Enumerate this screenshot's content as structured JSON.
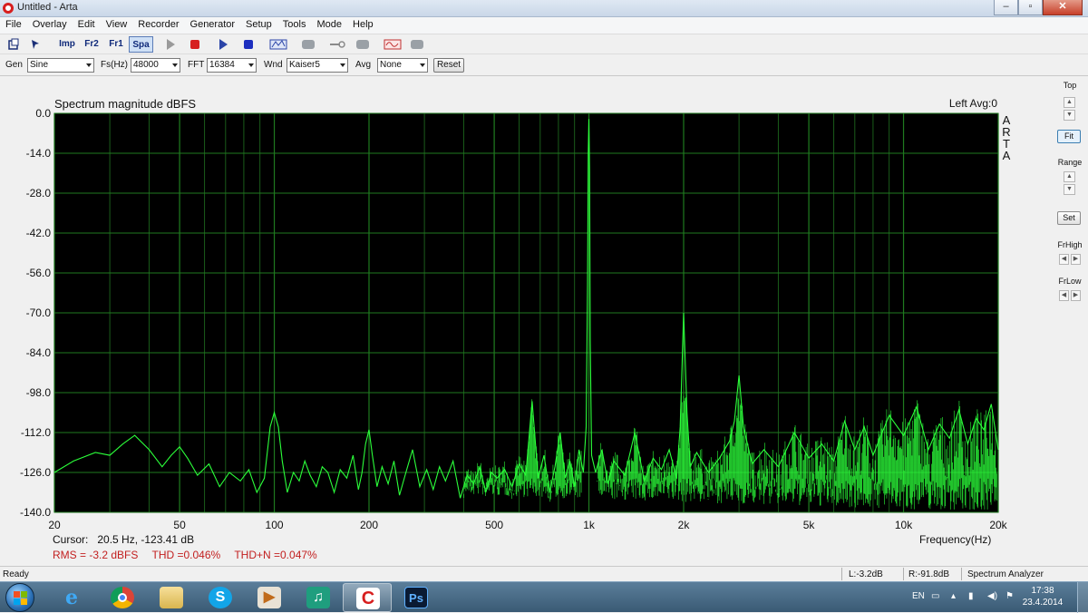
{
  "window": {
    "title": "Untitled - Arta"
  },
  "menu": [
    "File",
    "Overlay",
    "Edit",
    "View",
    "Recorder",
    "Generator",
    "Setup",
    "Tools",
    "Mode",
    "Help"
  ],
  "toolbar": {
    "imp": "Imp",
    "fr2": "Fr2",
    "fr1": "Fr1",
    "spa": "Spa"
  },
  "params": {
    "gen_label": "Gen",
    "gen_value": "Sine",
    "fs_label": "Fs(Hz)",
    "fs_value": "48000",
    "fft_label": "FFT",
    "fft_value": "16384",
    "wnd_label": "Wnd",
    "wnd_value": "Kaiser5",
    "avg_label": "Avg",
    "avg_value": "None",
    "reset_label": "Reset"
  },
  "plot": {
    "title": "Spectrum magnitude dBFS",
    "status": "Left  Avg:0",
    "side_text": "ARTA",
    "cursor_label": "Cursor:",
    "cursor_value": "20.5 Hz, -123.41 dB",
    "rms": "RMS =   -3.2 dBFS",
    "thd": "THD =0.046%",
    "thdn": "THD+N =0.047%",
    "freq_label": "Frequency(Hz)"
  },
  "chart_data": {
    "type": "line",
    "title": "Spectrum magnitude dBFS",
    "xlabel": "Frequency(Hz)",
    "ylabel": "",
    "xscale": "log",
    "xlim": [
      20,
      20000
    ],
    "ylim": [
      -140,
      0
    ],
    "grid": true,
    "colors": {
      "background": "#000000",
      "grid": "#1f7a1f",
      "trace": "#2bff3a"
    },
    "x_ticks": [
      "20",
      "50",
      "100",
      "200",
      "500",
      "1k",
      "2k",
      "5k",
      "10k",
      "20k"
    ],
    "x_tick_values": [
      20,
      50,
      100,
      200,
      500,
      1000,
      2000,
      5000,
      10000,
      20000
    ],
    "y_ticks": [
      "0.0",
      "-14.0",
      "-28.0",
      "-42.0",
      "-56.0",
      "-70.0",
      "-84.0",
      "-98.0",
      "-112.0",
      "-126.0",
      "-140.0"
    ],
    "series": [
      {
        "x": [
          20,
          23,
          27,
          30,
          33,
          36,
          40,
          44,
          47,
          50,
          53,
          57,
          62,
          67,
          72,
          78,
          83,
          88,
          93,
          97,
          100,
          103,
          106,
          110,
          115,
          120,
          125,
          130,
          136,
          142,
          148,
          155,
          162,
          170,
          178,
          185,
          190,
          195,
          200,
          205,
          212,
          220,
          230,
          240,
          250,
          262,
          275,
          290,
          305,
          320,
          335,
          350,
          370,
          390,
          410,
          430,
          450,
          470,
          490,
          510,
          540,
          570,
          600,
          630,
          660,
          690,
          720,
          750,
          780,
          810,
          840,
          870,
          900,
          930,
          960,
          980,
          990,
          995,
          1000,
          1005,
          1010,
          1020,
          1050,
          1100,
          1150,
          1200,
          1300,
          1400,
          1500,
          1600,
          1700,
          1800,
          1900,
          1950,
          2000,
          2050,
          2100,
          2200,
          2400,
          2600,
          2800,
          2900,
          3000,
          3100,
          3300,
          3600,
          4000,
          4500,
          5000,
          5500,
          6000,
          6500,
          7000,
          7500,
          8000,
          9000,
          10000,
          11000,
          12000,
          13000,
          14000,
          15000,
          16000,
          17000,
          18000,
          19000,
          20000
        ],
        "y": [
          -126,
          -122,
          -119,
          -120,
          -116,
          -113,
          -118,
          -124,
          -120,
          -117,
          -121,
          -127,
          -123,
          -131,
          -126,
          -129,
          -125,
          -133,
          -128,
          -110,
          -105,
          -110,
          -122,
          -133,
          -126,
          -129,
          -122,
          -127,
          -131,
          -124,
          -126,
          -133,
          -125,
          -128,
          -120,
          -132,
          -126,
          -116,
          -111,
          -120,
          -131,
          -124,
          -130,
          -122,
          -134,
          -126,
          -118,
          -131,
          -125,
          -132,
          -124,
          -129,
          -122,
          -135,
          -127,
          -130,
          -124,
          -133,
          -126,
          -128,
          -125,
          -131,
          -123,
          -127,
          -101,
          -128,
          -120,
          -133,
          -124,
          -112,
          -128,
          -122,
          -131,
          -118,
          -126,
          -110,
          -60,
          -14,
          -2,
          -20,
          -80,
          -120,
          -126,
          -118,
          -130,
          -122,
          -127,
          -112,
          -129,
          -121,
          -125,
          -118,
          -128,
          -110,
          -70,
          -105,
          -124,
          -119,
          -126,
          -121,
          -115,
          -108,
          -92,
          -110,
          -123,
          -118,
          -124,
          -112,
          -121,
          -116,
          -122,
          -108,
          -118,
          -110,
          -120,
          -106,
          -113,
          -103,
          -118,
          -109,
          -114,
          -104,
          -116,
          -107,
          -111,
          -102,
          -118
        ]
      }
    ]
  },
  "side": {
    "top_label": "Top",
    "fit_label": "Fit",
    "range_label": "Range",
    "set_label": "Set",
    "frhigh_label": "FrHigh",
    "frlow_label": "FrLow"
  },
  "statusbar": {
    "ready": "Ready",
    "left": "L:-3.2dB",
    "right": "R:-91.8dB",
    "mode": "Spectrum Analyzer"
  },
  "taskbar": {
    "lang": "EN",
    "time": "17:38",
    "date": "23.4.2014",
    "apps": [
      "internet-explorer",
      "chrome",
      "file-explorer",
      "skype",
      "media-player",
      "music-player",
      "arta",
      "photoshop"
    ]
  }
}
